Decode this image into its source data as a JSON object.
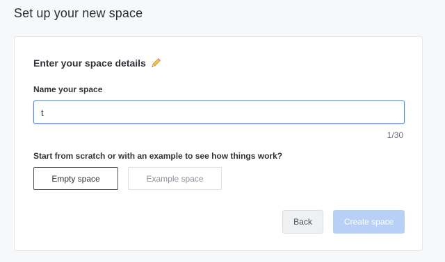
{
  "page": {
    "title": "Set up your new space"
  },
  "details": {
    "heading": "Enter your space details",
    "heading_icon": "pencil-icon",
    "name_label": "Name your space",
    "name_value": "t",
    "char_count": "1/30"
  },
  "template": {
    "question": "Start from scratch or with an example to see how things work?",
    "options": [
      {
        "label": "Empty space",
        "selected": true
      },
      {
        "label": "Example space",
        "selected": false
      }
    ]
  },
  "actions": {
    "back_label": "Back",
    "create_label": "Create space",
    "create_enabled": false
  },
  "colors": {
    "accent": "#4a86e8",
    "primary_disabled": "#b8d0f5"
  }
}
